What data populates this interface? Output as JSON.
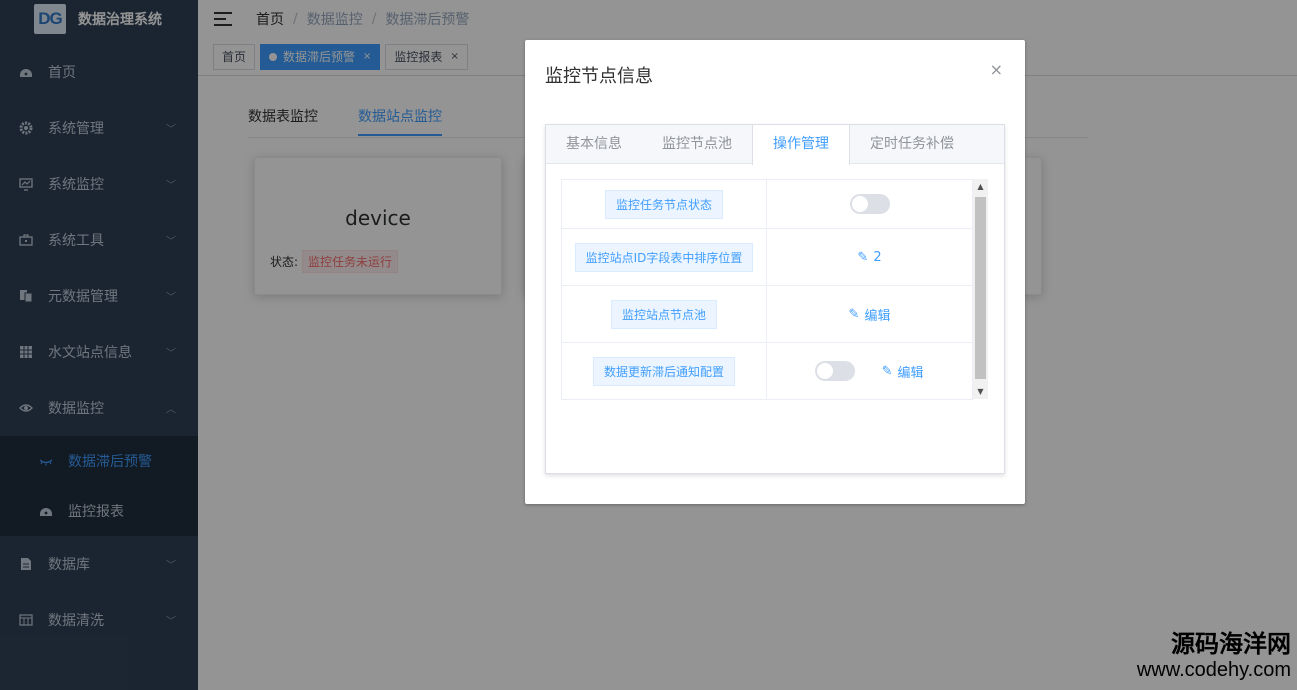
{
  "app": {
    "logo_text": "DG",
    "title": "数据治理系统"
  },
  "sidebar": {
    "items": [
      {
        "label": "首页",
        "icon": "dashboard-icon",
        "has_arrow": false
      },
      {
        "label": "系统管理",
        "icon": "gear-icon",
        "has_arrow": true
      },
      {
        "label": "系统监控",
        "icon": "monitor-icon",
        "has_arrow": true
      },
      {
        "label": "系统工具",
        "icon": "toolbox-icon",
        "has_arrow": true
      },
      {
        "label": "元数据管理",
        "icon": "documents-icon",
        "has_arrow": true
      },
      {
        "label": "水文站点信息",
        "icon": "grid-icon",
        "has_arrow": true
      },
      {
        "label": "数据监控",
        "icon": "eye-icon",
        "has_arrow": true,
        "expanded": true
      },
      {
        "label": "数据库",
        "icon": "file-icon",
        "has_arrow": true
      },
      {
        "label": "数据清洗",
        "icon": "table-icon",
        "has_arrow": true
      }
    ],
    "sub_items": [
      {
        "label": "数据滞后预警",
        "icon": "eye-closed-icon",
        "active": true
      },
      {
        "label": "监控报表",
        "icon": "dashboard-icon",
        "active": false
      }
    ]
  },
  "breadcrumb": [
    "首页",
    "数据监控",
    "数据滞后预警"
  ],
  "tags": [
    {
      "label": "首页",
      "active": false,
      "closable": false
    },
    {
      "label": "数据滞后预警",
      "active": true,
      "closable": true
    },
    {
      "label": "监控报表",
      "active": false,
      "closable": true
    }
  ],
  "content_tabs": [
    {
      "label": "数据表监控",
      "active": false
    },
    {
      "label": "数据站点监控",
      "active": true
    }
  ],
  "device_card": {
    "name": "device",
    "status_label": "状态:",
    "status_value": "监控任务未运行"
  },
  "dialog": {
    "title": "监控节点信息",
    "close_glyph": "×",
    "tabs": [
      {
        "label": "基本信息",
        "active": false
      },
      {
        "label": "监控节点池",
        "active": false
      },
      {
        "label": "操作管理",
        "active": true
      },
      {
        "label": "定时任务补偿",
        "active": false
      }
    ],
    "rows": [
      {
        "label": "监控任务节点状态",
        "switch": true,
        "switch_on": false
      },
      {
        "label": "监控站点ID字段表中排序位置",
        "edit_text": "2"
      },
      {
        "label": "监控站点节点池",
        "edit_text": "编辑"
      },
      {
        "label": "数据更新滞后通知配置",
        "switch": true,
        "switch_on": false,
        "edit_text": "编辑"
      }
    ]
  },
  "watermark": {
    "line1": "源码海洋网",
    "line2": "www.codehy.com"
  }
}
